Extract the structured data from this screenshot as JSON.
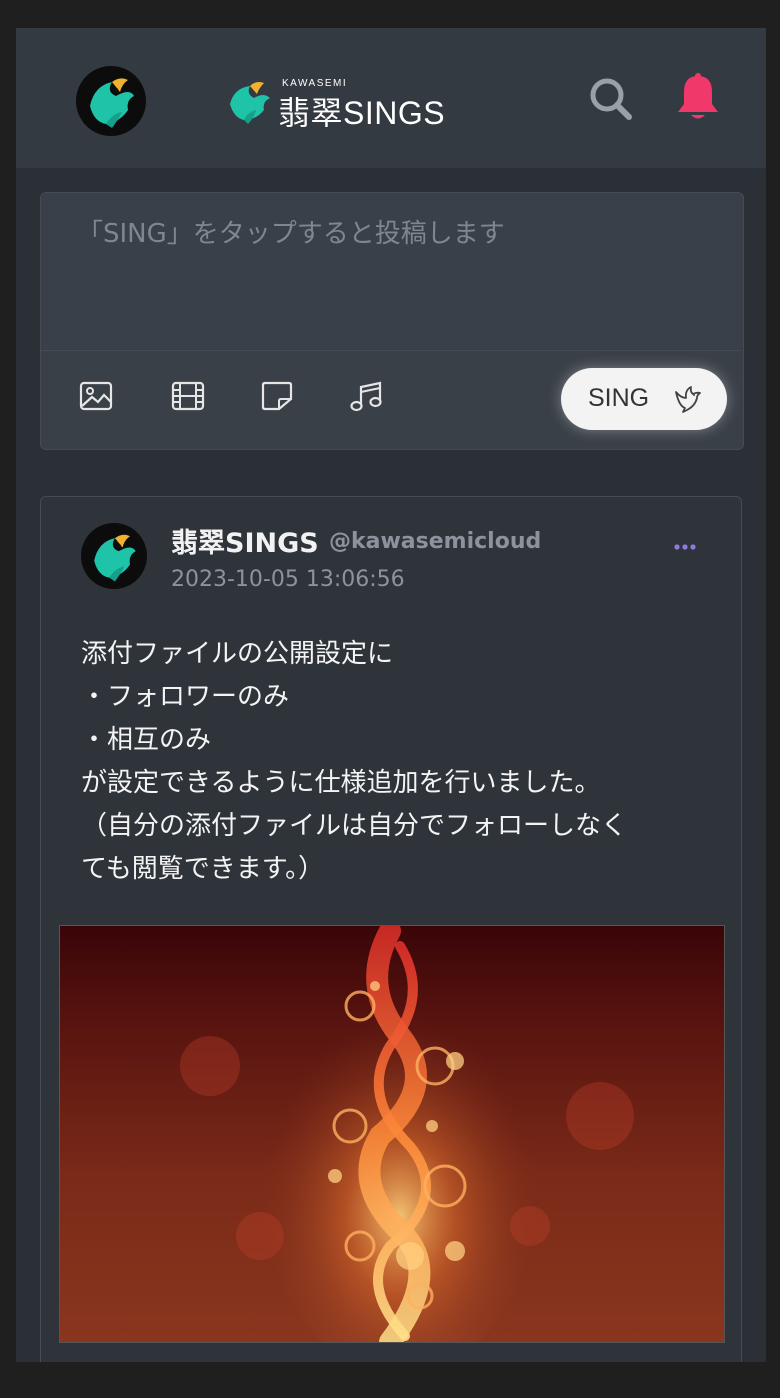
{
  "header": {
    "brand_small": "KAWASEMI",
    "brand_main": "翡翠SINGS",
    "avatar_icon": "kawasemi-bird-icon",
    "search_icon": "search-icon",
    "notification_icon": "bell-icon",
    "notification_color": "#f0386b"
  },
  "composer": {
    "placeholder": "「SING」をタップすると投稿します",
    "tools": [
      "image-icon",
      "video-icon",
      "sticker-icon",
      "music-icon"
    ],
    "sing_label": "SING",
    "sing_icon": "bird-icon"
  },
  "post": {
    "author_name": "翡翠SINGS",
    "author_handle": "@kawasemicloud",
    "timestamp": "2023-10-05 13:06:56",
    "body": "添付ファイルの公開設定に\n・フォロワーのみ\n・相互のみ\nが設定できるように仕様追加を行いました。\n（自分の添付ファイルは自分でフォローしなく\nても閲覧できます。）",
    "more_icon": "more-dots-icon",
    "more_color": "#8e7be0",
    "image": "fire-swirl-image"
  },
  "colors": {
    "background": "#2b3037",
    "header": "#343a42",
    "accent_teal": "#1ec3a8"
  }
}
